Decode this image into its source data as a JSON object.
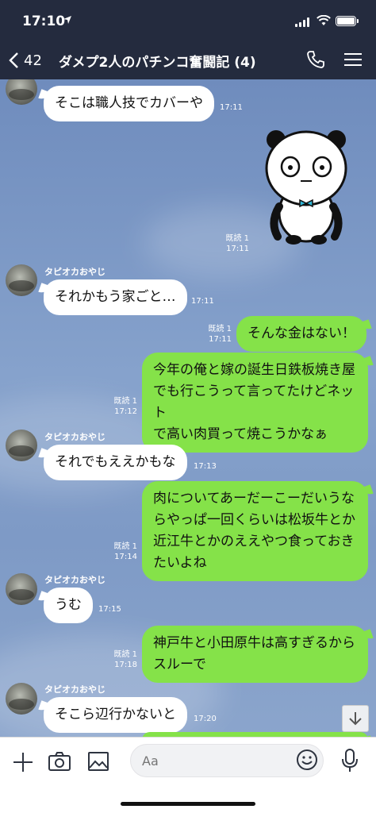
{
  "status": {
    "time": "17:10"
  },
  "nav": {
    "back_count": "42",
    "title": "ダメプ2人のパチンコ奮闘記 (4)"
  },
  "messages": [
    {
      "side": "left",
      "text": "そこは職人技でカバーや",
      "time": "17:11"
    },
    {
      "side": "right",
      "type": "sticker",
      "sticker": "panda-sticker",
      "read": "既読 1",
      "time": "17:11"
    },
    {
      "side": "left",
      "sender": "タピオカおやじ",
      "text": "それかもう家ごと…",
      "time": "17:11"
    },
    {
      "side": "right",
      "text": "そんな金はない！",
      "read": "既読 1",
      "time": "17:11"
    },
    {
      "side": "right",
      "lines": [
        "今年の俺と嫁の誕生日鉄板焼き屋",
        "でも行こうって言ってたけどネット",
        "で高い肉買って焼こうかなぁ"
      ],
      "read": "既読 1",
      "time": "17:12"
    },
    {
      "side": "left",
      "sender": "タピオカおやじ",
      "text": "それでもええかもな",
      "time": "17:13"
    },
    {
      "side": "right",
      "lines": [
        "肉についてあーだーこーだいうな",
        "らやっぱ一回くらいは松坂牛とか",
        "近江牛とかのええやつ食っておき",
        "たいよね"
      ],
      "read": "既読 1",
      "time": "17:14"
    },
    {
      "side": "left",
      "sender": "タピオカおやじ",
      "text": "うむ",
      "time": "17:15"
    },
    {
      "side": "right",
      "lines": [
        "神戸牛と小田原牛は高すぎるから",
        "スルーで"
      ],
      "read": "既読 1",
      "time": "17:18"
    },
    {
      "side": "left",
      "sender": "タピオカおやじ",
      "text": "そこら辺行かないと",
      "time": "17:20"
    }
  ],
  "input": {
    "placeholder": "Aa"
  },
  "icons": [
    "back-chevron-icon",
    "call-icon",
    "menu-icon",
    "plus-icon",
    "camera-icon",
    "image-icon",
    "emoji-icon",
    "mic-icon",
    "scroll-down-icon"
  ],
  "colors": {
    "header": "#242b3e",
    "chat_bg": "#7b98c4",
    "bubble_right": "#85e249",
    "bubble_left": "#ffffff"
  }
}
